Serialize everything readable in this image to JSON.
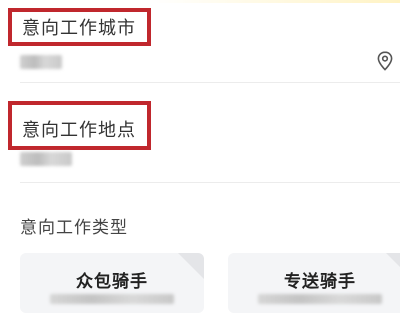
{
  "form": {
    "city": {
      "label": "意向工作城市",
      "icon": "location-pin-icon"
    },
    "location": {
      "label": "意向工作地点"
    },
    "job_type": {
      "label": "意向工作类型",
      "options": [
        {
          "title": "众包骑手"
        },
        {
          "title": "专送骑手"
        }
      ]
    }
  },
  "colors": {
    "highlight_border": "#c0272d",
    "card_background": "#f4f5f7"
  }
}
